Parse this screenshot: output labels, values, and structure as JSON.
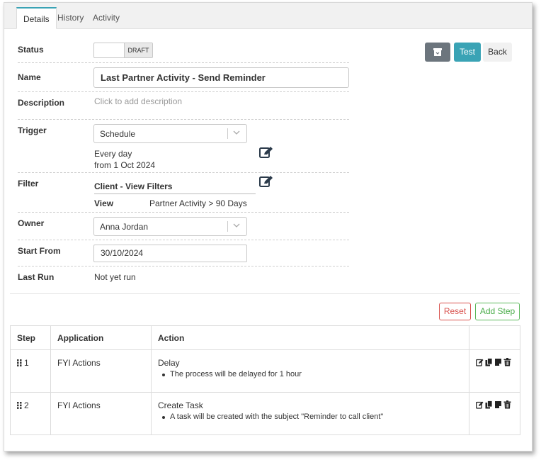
{
  "tabs": [
    {
      "label": "Details"
    },
    {
      "label": "History"
    },
    {
      "label": "Activity"
    }
  ],
  "active_tab": "Details",
  "fields": {
    "status": {
      "label": "Status",
      "value": "DRAFT"
    },
    "name": {
      "label": "Name",
      "value": "Last Partner Activity - Send Reminder"
    },
    "description": {
      "label": "Description",
      "placeholder": "Click to add description"
    },
    "trigger": {
      "label": "Trigger",
      "value": "Schedule",
      "line1": "Every day",
      "line2": "from 1 Oct 2024"
    },
    "filter": {
      "label": "Filter",
      "link": "Client - View Filters",
      "key": "View",
      "value": "Partner Activity > 90 Days"
    },
    "owner": {
      "label": "Owner",
      "value": "Anna Jordan"
    },
    "start_from": {
      "label": "Start From",
      "value": "30/10/2024"
    },
    "last_run": {
      "label": "Last Run",
      "value": "Not yet run"
    }
  },
  "buttons": {
    "test": "Test",
    "back": "Back",
    "reset": "Reset",
    "add_step": "Add Step"
  },
  "table": {
    "headers": [
      "Step",
      "Application",
      "Action"
    ],
    "rows": [
      {
        "step": "1",
        "application": "FYI Actions",
        "action": "Delay",
        "detail": "The process will be delayed for 1 hour"
      },
      {
        "step": "2",
        "application": "FYI Actions",
        "action": "Create Task",
        "detail": "A task will be created with the subject \"Reminder to call client\""
      }
    ]
  },
  "colors": {
    "accent": "#3aa3b5",
    "archive_button": "#6c757d",
    "reset": "#d9534f",
    "add_step": "#5cb85c"
  },
  "icons": {
    "archive": "archive-icon",
    "edit": "edit-icon",
    "row_actions": [
      "edit-icon",
      "copy-icon",
      "paste-icon",
      "trash-icon"
    ],
    "drag": "drag-handle-icon"
  }
}
